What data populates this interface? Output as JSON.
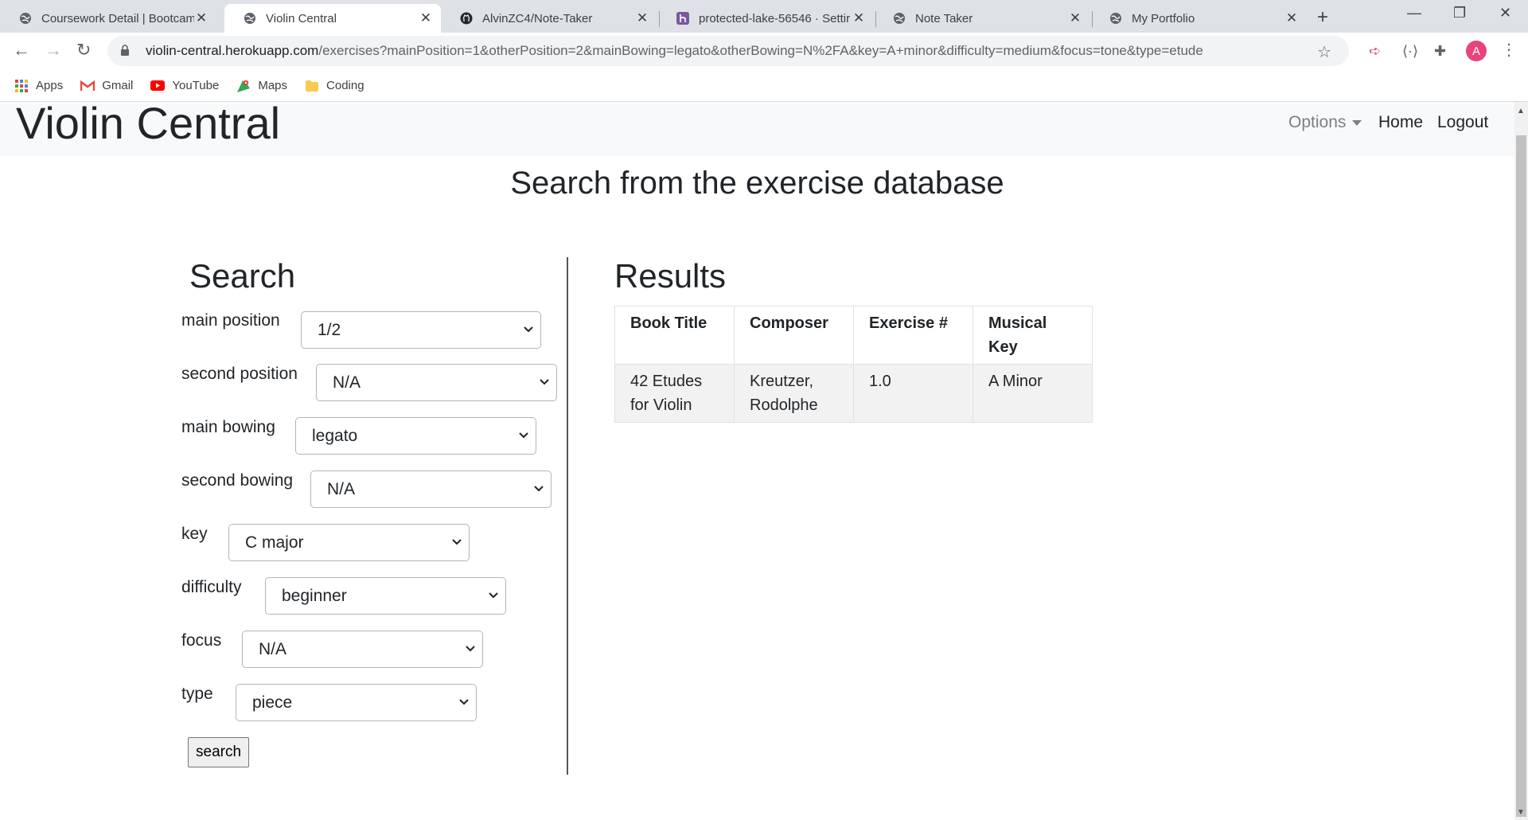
{
  "browser": {
    "tabs": [
      {
        "title": "Coursework Detail | Bootcam",
        "icon": "globe-icon"
      },
      {
        "title": "Violin Central",
        "icon": "globe-icon",
        "active": true
      },
      {
        "title": "AlvinZC4/Note-Taker",
        "icon": "github-icon"
      },
      {
        "title": "protected-lake-56546 · Settir",
        "icon": "heroku-icon"
      },
      {
        "title": "Note Taker",
        "icon": "globe-icon"
      },
      {
        "title": "My Portfolio",
        "icon": "globe-icon"
      }
    ],
    "url_host": "violin-central.herokuapp.com",
    "url_path": "/exercises?mainPosition=1&otherPosition=2&mainBowing=legato&otherBowing=N%2FA&key=A+minor&difficulty=medium&focus=tone&type=etude",
    "profile_initial": "A",
    "bookmarks": [
      {
        "label": "Apps",
        "icon": "apps-grid-icon"
      },
      {
        "label": "Gmail",
        "icon": "gmail-icon"
      },
      {
        "label": "YouTube",
        "icon": "youtube-icon"
      },
      {
        "label": "Maps",
        "icon": "maps-icon"
      },
      {
        "label": "Coding",
        "icon": "folder-icon"
      }
    ]
  },
  "site": {
    "brand": "Violin Central",
    "nav": {
      "options": "Options",
      "home": "Home",
      "logout": "Logout"
    },
    "page_title": "Search from the exercise database"
  },
  "search": {
    "heading": "Search",
    "fields": [
      {
        "label": "main position",
        "value": "1/2"
      },
      {
        "label": "second position",
        "value": "N/A"
      },
      {
        "label": "main bowing",
        "value": "legato"
      },
      {
        "label": "second bowing",
        "value": "N/A"
      },
      {
        "label": "key",
        "value": "C major"
      },
      {
        "label": "difficulty",
        "value": "beginner"
      },
      {
        "label": "focus",
        "value": "N/A"
      },
      {
        "label": "type",
        "value": "piece"
      }
    ],
    "button": "search"
  },
  "results": {
    "heading": "Results",
    "columns": [
      "Book Title",
      "Composer",
      "Exercise #",
      "Musical Key"
    ],
    "rows": [
      [
        "42 Etudes for Violin",
        "Kreutzer, Rodolphe",
        "1.0",
        "A Minor"
      ]
    ]
  }
}
